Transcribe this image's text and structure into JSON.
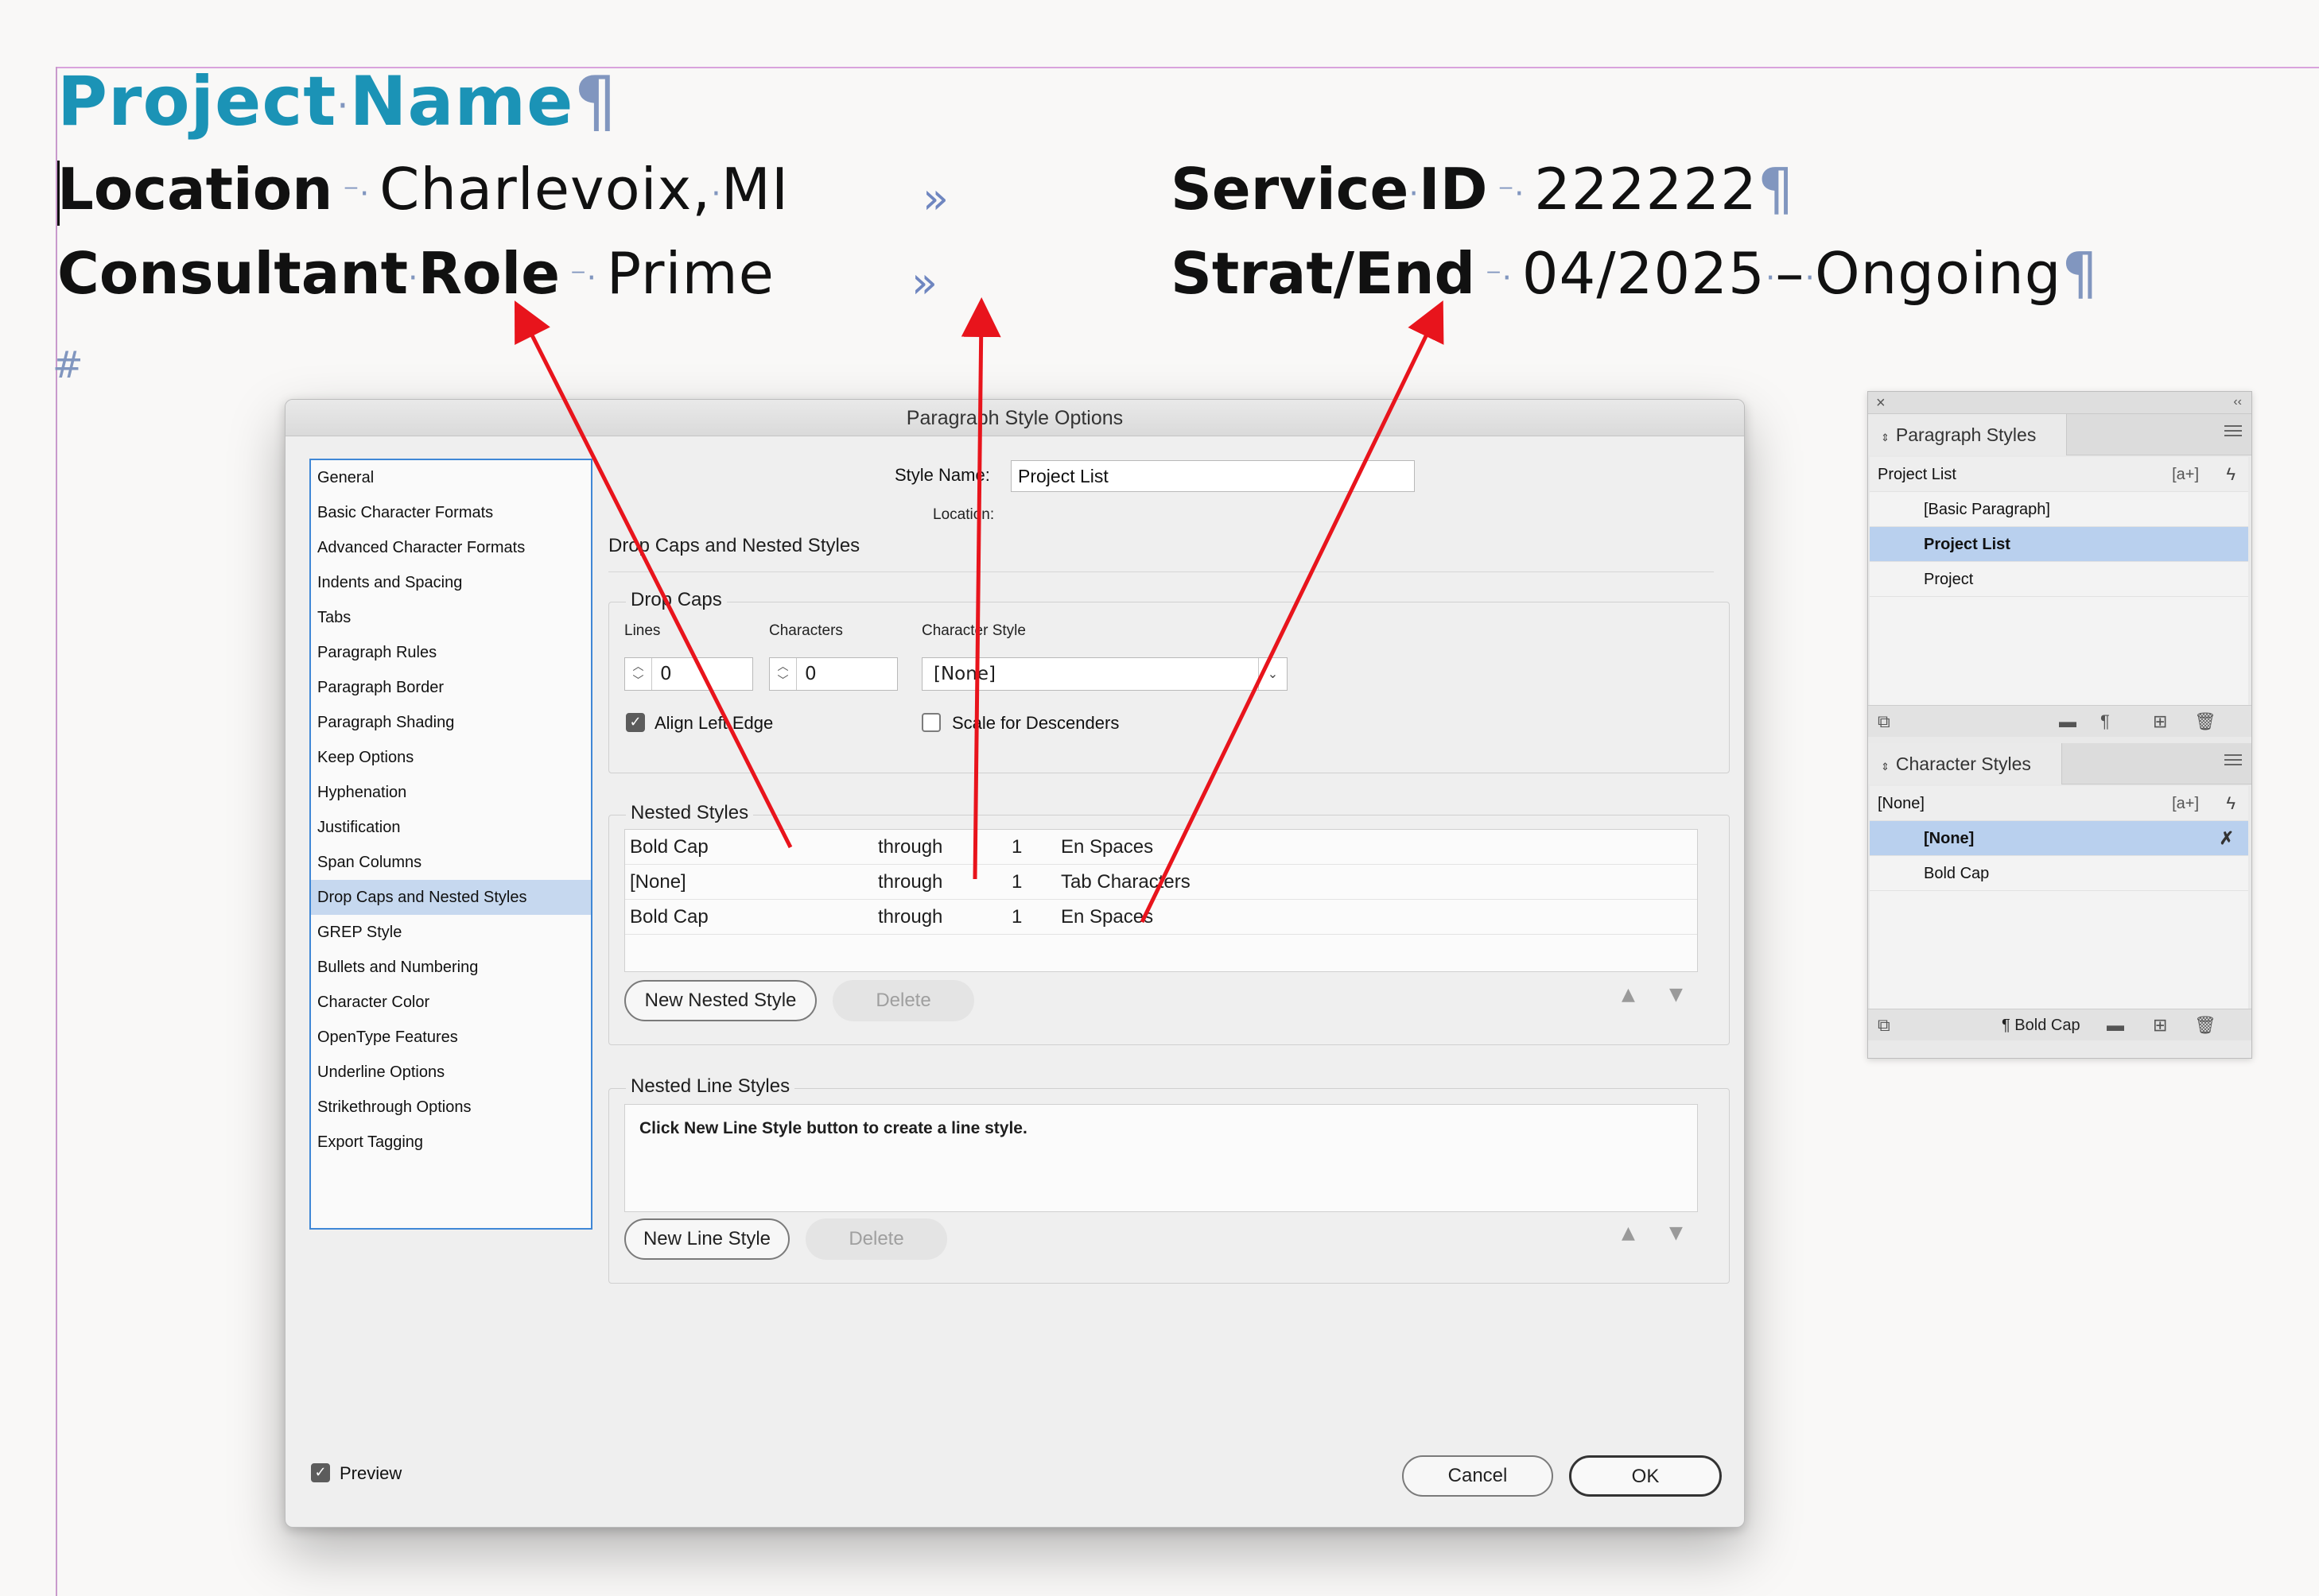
{
  "document": {
    "title_a": "Project",
    "title_b": "Name",
    "title_pilcrow": "¶",
    "row1": {
      "label_a": "Location",
      "value": "Charlevoix,",
      "value_b": "MI",
      "tab": "»",
      "label2_a": "Service",
      "label2_b": "ID",
      "value2": "222222",
      "pilcrow": "¶"
    },
    "row2": {
      "label_a": "Consultant",
      "label_b": "Role",
      "value": "Prime",
      "tab": "»",
      "label2": "Strat/End",
      "value2": "04/2025",
      "dash": "–",
      "value2_b": "Ongoing",
      "pilcrow": "¶"
    },
    "end_marker": "#"
  },
  "dialog": {
    "title": "Paragraph Style Options",
    "nav_items": [
      "General",
      "Basic Character Formats",
      "Advanced Character Formats",
      "Indents and Spacing",
      "Tabs",
      "Paragraph Rules",
      "Paragraph Border",
      "Paragraph Shading",
      "Keep Options",
      "Hyphenation",
      "Justification",
      "Span Columns",
      "Drop Caps and Nested Styles",
      "GREP Style",
      "Bullets and Numbering",
      "Character Color",
      "OpenType Features",
      "Underline Options",
      "Strikethrough Options",
      "Export Tagging"
    ],
    "selected_nav": "Drop Caps and Nested Styles",
    "style_name_label": "Style Name:",
    "style_name_value": "Project List",
    "location_label": "Location:",
    "section_title": "Drop Caps and Nested Styles",
    "drop_caps": {
      "title": "Drop Caps",
      "lines_label": "Lines",
      "lines_value": "0",
      "characters_label": "Characters",
      "characters_value": "0",
      "char_style_label": "Character Style",
      "char_style_value": "[None]",
      "align_left_edge": "Align Left Edge",
      "align_left_edge_checked": true,
      "scale_descenders": "Scale for Descenders",
      "scale_descenders_checked": false
    },
    "nested_styles": {
      "title": "Nested Styles",
      "rows": [
        {
          "style": "Bold Cap",
          "mode": "through",
          "count": "1",
          "delimiter": "En Spaces"
        },
        {
          "style": "[None]",
          "mode": "through",
          "count": "1",
          "delimiter": "Tab Characters"
        },
        {
          "style": "Bold Cap",
          "mode": "through",
          "count": "1",
          "delimiter": "En Spaces"
        }
      ],
      "new_button": "New Nested Style",
      "delete_button": "Delete"
    },
    "nested_line_styles": {
      "title": "Nested Line Styles",
      "hint": "Click New Line Style button to create a line style.",
      "new_button": "New Line Style",
      "delete_button": "Delete"
    },
    "preview_label": "Preview",
    "preview_checked": true,
    "cancel_button": "Cancel",
    "ok_button": "OK"
  },
  "paragraph_panel": {
    "tab_label": "Paragraph Styles",
    "current_style": "Project List",
    "new_style_icon_label": "[a+]",
    "items": [
      "[Basic Paragraph]",
      "Project List",
      "Project"
    ],
    "selected": "Project List"
  },
  "character_panel": {
    "tab_label": "Character Styles",
    "current_style": "[None]",
    "new_style_icon_label": "[a+]",
    "items": [
      "[None]",
      "Bold Cap"
    ],
    "selected": "[None]",
    "footer_label": "¶ Bold Cap"
  },
  "colors": {
    "title_blue": "#1b93b6",
    "invisible_chars": "#8196bf",
    "selection_blue": "#c6d8ef",
    "arrow_red": "#e8141c"
  }
}
